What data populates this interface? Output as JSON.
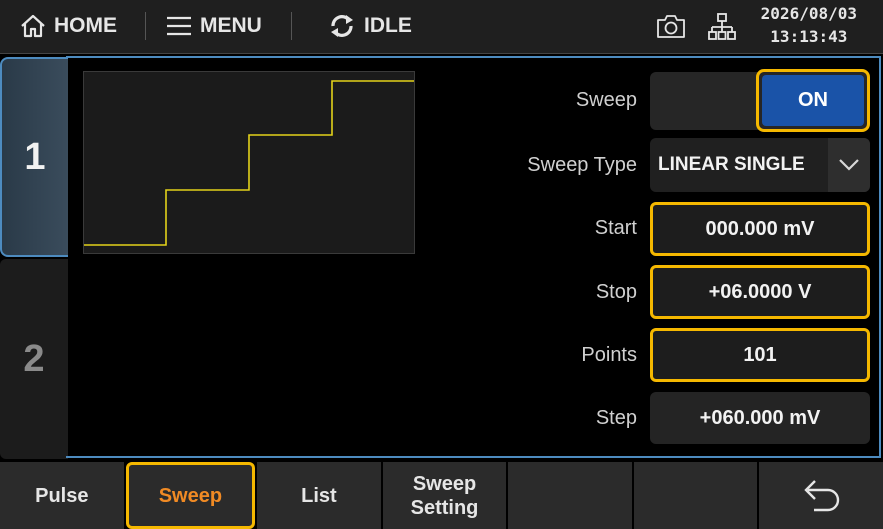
{
  "topbar": {
    "home_label": "HOME",
    "menu_label": "MENU",
    "status_label": "IDLE",
    "date": "2026/08/03",
    "time": "13:13:43"
  },
  "channels": {
    "ch1": "1",
    "ch2": "2"
  },
  "sweep": {
    "sweep_label": "Sweep",
    "sweep_state": "ON",
    "type_label": "Sweep Type",
    "type_value": "LINEAR SINGLE",
    "start_label": "Start",
    "start_value": "000.000 mV",
    "stop_label": "Stop",
    "stop_value": "+06.0000 V",
    "points_label": "Points",
    "points_value": "101",
    "step_label": "Step",
    "step_value": "+060.000 mV"
  },
  "softkeys": {
    "pulse": "Pulse",
    "sweep": "Sweep",
    "list": "List",
    "sweep_setting_1": "Sweep",
    "sweep_setting_2": "Setting"
  },
  "colors": {
    "accent_focus": "#f5b800",
    "on_button": "#1a53a8",
    "active_softkey_text": "#f08a24",
    "waveform": "#e3d21b",
    "panel_border": "#4d8bbf"
  }
}
